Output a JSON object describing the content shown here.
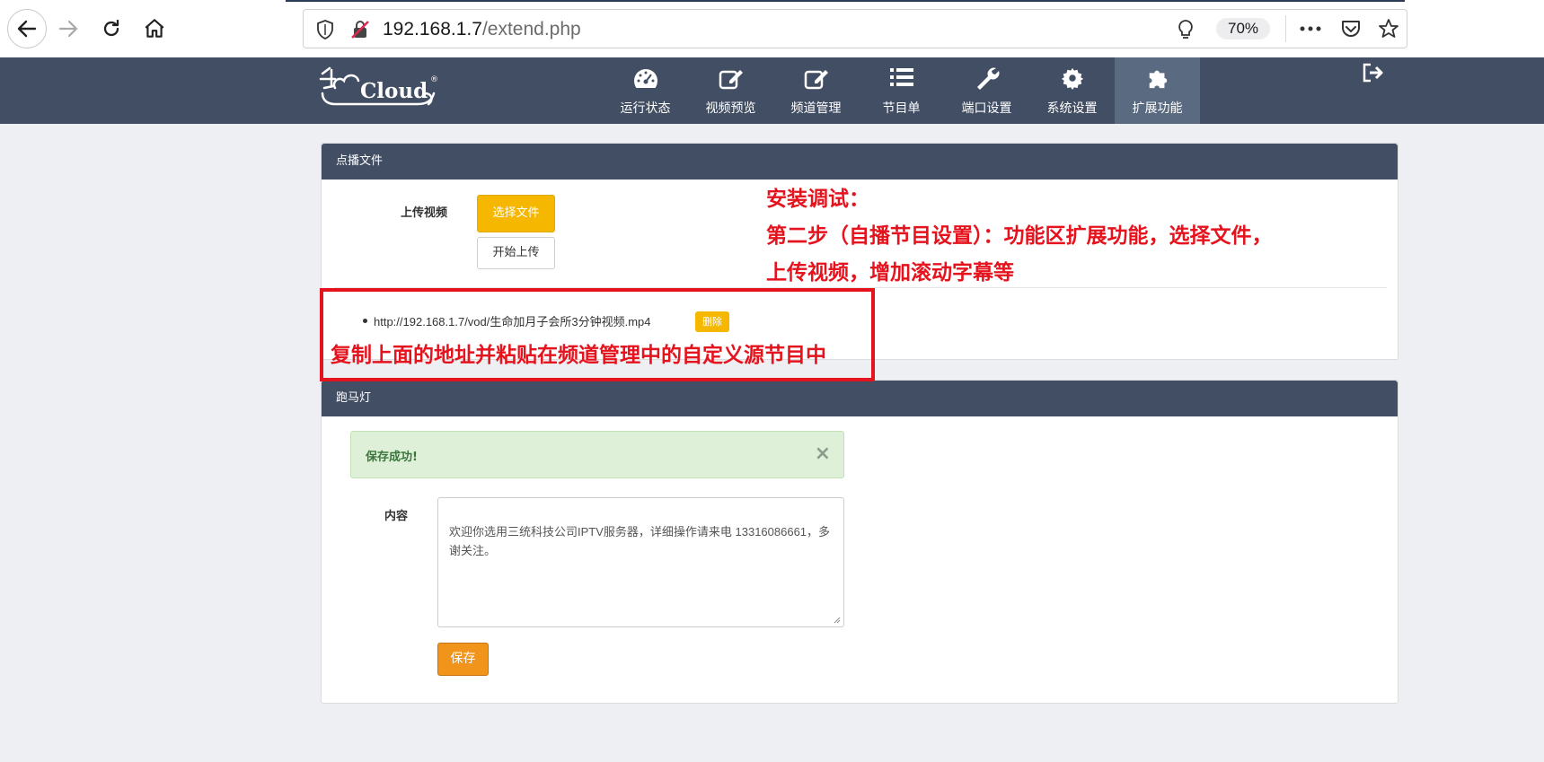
{
  "browser": {
    "url_host": "192.168.1.7",
    "url_path": "/extend.php",
    "zoom": "70%"
  },
  "app": {
    "logo_text": "Cloud",
    "logo_reg": "®",
    "nav": [
      {
        "label": "运行状态",
        "icon": "dashboard-icon"
      },
      {
        "label": "视频预览",
        "icon": "edit-icon"
      },
      {
        "label": "频道管理",
        "icon": "edit-icon"
      },
      {
        "label": "节目单",
        "icon": "list-icon"
      },
      {
        "label": "端口设置",
        "icon": "wrench-icon"
      },
      {
        "label": "系统设置",
        "icon": "gear-icon"
      },
      {
        "label": "扩展功能",
        "icon": "puzzle-icon",
        "active": true
      }
    ]
  },
  "vod_panel": {
    "title": "点播文件",
    "upload_label": "上传视频",
    "choose_button": "选择文件",
    "start_button": "开始上传",
    "file_url": "http://192.168.1.7/vod/生命加月子会所3分钟视频.mp4",
    "delete_button": "删除"
  },
  "marquee_panel": {
    "title": "跑马灯",
    "alert_message": "保存成功!",
    "alert_close": "×",
    "content_label": "内容",
    "content_value": "欢迎你选用三统科技公司IPTV服务器，详细操作请来电 13316086661，多谢关注。",
    "save_button": "保存"
  },
  "annotations": {
    "step_line1": "安装调试：",
    "step_line2": "第二步（自播节目设置）：功能区扩展功能，选择文件，",
    "step_line3": "上传视频，增加滚动字幕等",
    "copy_note": "复制上面的地址并粘贴在频道管理中的自定义源节目中",
    "color": "#e5131d"
  }
}
